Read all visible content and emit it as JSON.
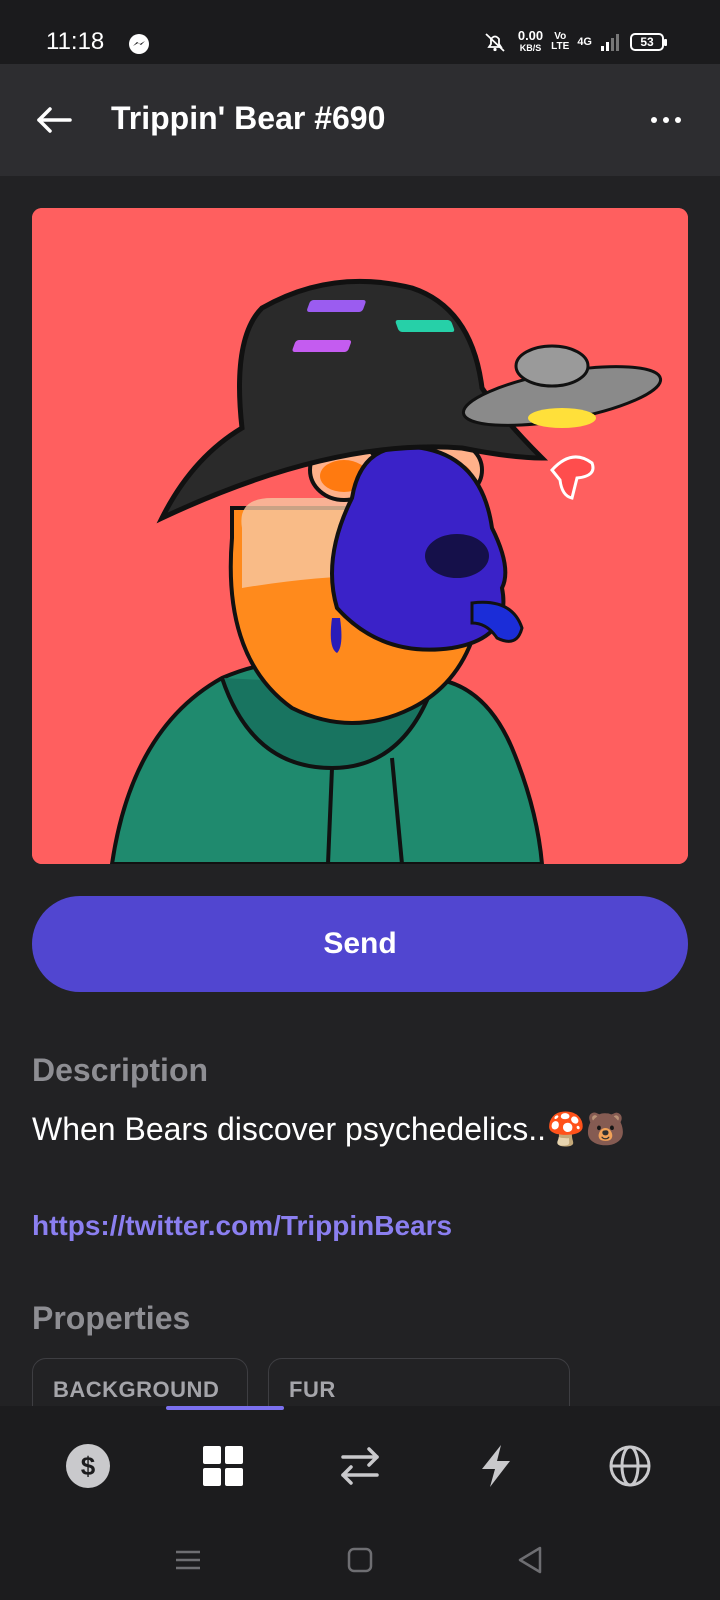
{
  "status_bar": {
    "time": "11:18",
    "net_speed": "0.00",
    "net_speed_unit": "KB/S",
    "volte_top": "Vo",
    "volte_bottom": "LTE",
    "network": "4G",
    "battery": "53"
  },
  "header": {
    "title": "Trippin' Bear #690",
    "back_icon": "arrow-left-icon",
    "more_icon": "more-horizontal-icon"
  },
  "nft": {
    "background_color": "#ff5f5f"
  },
  "actions": {
    "send_label": "Send",
    "send_color": "#5146d0"
  },
  "description": {
    "title": "Description",
    "text": "When Bears discover psychedelics..🍄🐻",
    "link": "https://twitter.com/TrippinBears",
    "link_color": "#8b7ff0"
  },
  "properties": {
    "title": "Properties",
    "items": [
      {
        "label": "BACKGROUND"
      },
      {
        "label": "FUR"
      }
    ]
  },
  "tabs": [
    {
      "name": "wallet",
      "icon": "dollar-icon"
    },
    {
      "name": "collectibles",
      "icon": "grid-icon",
      "active": true
    },
    {
      "name": "swap",
      "icon": "swap-icon"
    },
    {
      "name": "activity",
      "icon": "lightning-icon"
    },
    {
      "name": "browser",
      "icon": "globe-icon"
    }
  ],
  "accent_color": "#7b70ee"
}
